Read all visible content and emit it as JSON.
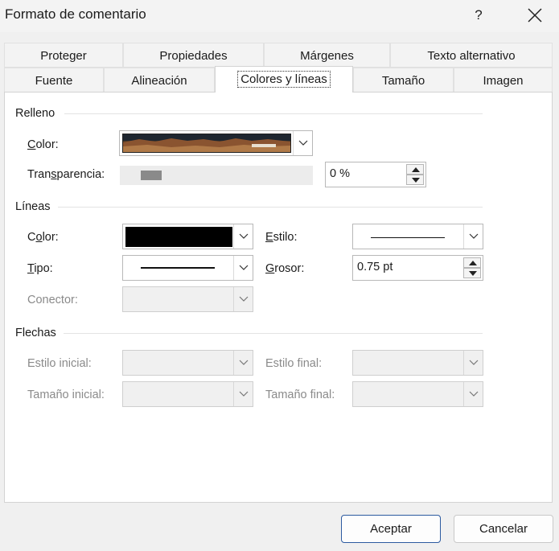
{
  "window": {
    "title": "Formato de comentario",
    "help_label": "?"
  },
  "tabs": {
    "row1": [
      "Proteger",
      "Propiedades",
      "Márgenes",
      "Texto alternativo"
    ],
    "row2": [
      "Fuente",
      "Alineación",
      "Colores y líneas",
      "Tamaño",
      "Imagen"
    ],
    "active": "Colores y líneas"
  },
  "relleno": {
    "heading": "Relleno",
    "color_label": "Color:",
    "transparency_label": "Transparencia:",
    "transparency_value": "0 %",
    "transparency_level": 0
  },
  "lineas": {
    "heading": "Líneas",
    "color_label": "Color:",
    "color_value": "#000000",
    "tipo_label": "Tipo:",
    "conector_label": "Conector:",
    "estilo_label": "Estilo:",
    "grosor_label": "Grosor:",
    "grosor_value": "0.75 pt"
  },
  "flechas": {
    "heading": "Flechas",
    "estilo_inicial_label": "Estilo inicial:",
    "tamano_inicial_label": "Tamaño inicial:",
    "estilo_final_label": "Estilo final:",
    "tamano_final_label": "Tamaño final:"
  },
  "buttons": {
    "ok": "Aceptar",
    "cancel": "Cancelar"
  },
  "icons": {
    "close": "close-icon",
    "dropdown": "chevron-down-icon",
    "spin_up": "spin-up-icon",
    "spin_down": "spin-down-icon"
  }
}
